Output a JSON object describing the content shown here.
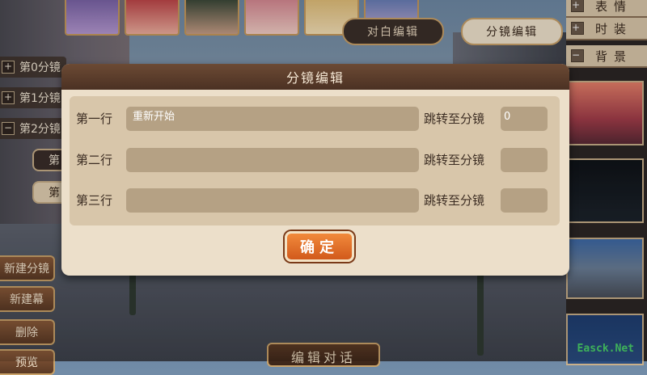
{
  "top_bar": {
    "portraits": [
      "portrait-1",
      "portrait-2",
      "portrait-3",
      "portrait-4",
      "portrait-5",
      "portrait-6"
    ],
    "portrait_colors": [
      "#7b64a8",
      "#c0474a",
      "#3d4a3a",
      "#d88a94",
      "#e3c07a",
      "#6a7fb8"
    ],
    "dialog_edit_label": "对白编辑",
    "storyboard_edit_label": "分镜编辑"
  },
  "left_panel": {
    "items": [
      {
        "icon": "plus-icon",
        "label": "第0分镜"
      },
      {
        "icon": "plus-icon",
        "label": "第1分镜"
      },
      {
        "icon": "minus-icon",
        "label": "第2分镜"
      }
    ],
    "sub_tabs": [
      "第",
      "第"
    ],
    "buttons": [
      "新建分镜",
      "新建幕",
      "删除",
      "预览"
    ]
  },
  "right_panel": {
    "items": [
      {
        "icon": "plus-icon",
        "label": "表情"
      },
      {
        "icon": "plus-icon",
        "label": "时装"
      },
      {
        "icon": "minus-icon",
        "label": "背景"
      }
    ]
  },
  "bottom": {
    "edit_dialog_label": "编辑对话",
    "watermark": "Easck.Net"
  },
  "modal": {
    "title": "分镜编辑",
    "rows": [
      {
        "label": "第一行",
        "value": "重新开始",
        "jump_label": "跳转至分镜",
        "jump_value": "0"
      },
      {
        "label": "第二行",
        "value": "",
        "jump_label": "跳转至分镜",
        "jump_value": ""
      },
      {
        "label": "第三行",
        "value": "",
        "jump_label": "跳转至分镜",
        "jump_value": ""
      }
    ],
    "confirm_label": "确定"
  },
  "colors": {
    "modal_bg": "#ecdfca",
    "header_bg": "#5a3c2a",
    "confirm_orange": "#e8712c",
    "watermark_green": "#49d16a"
  }
}
